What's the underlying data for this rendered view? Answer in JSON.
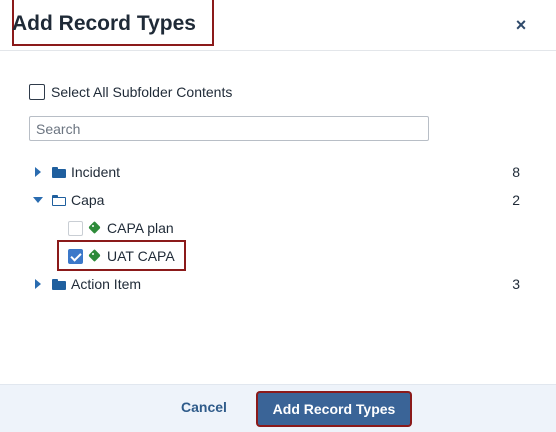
{
  "dialog": {
    "title": "Add Record Types",
    "close_label": "×"
  },
  "select_all": {
    "label": "Select All Subfolder Contents",
    "checked": false
  },
  "search": {
    "placeholder": "Search",
    "value": ""
  },
  "tree": {
    "folders": [
      {
        "name": "Incident",
        "count": "8",
        "expanded": false
      },
      {
        "name": "Capa",
        "count": "2",
        "expanded": true,
        "children": [
          {
            "name": "CAPA plan",
            "checked": false
          },
          {
            "name": "UAT CAPA",
            "checked": true
          }
        ]
      },
      {
        "name": "Action Item",
        "count": "3",
        "expanded": false
      }
    ]
  },
  "footer": {
    "cancel_label": "Cancel",
    "submit_label": "Add Record Types"
  },
  "colors": {
    "primary_button": "#3a6497",
    "highlight_outline": "#8b1a1a",
    "tag_icon": "#2e8b3a",
    "folder_icon": "#1f5f9e",
    "footer_bg": "#eef3fa"
  },
  "icons": {
    "close": "close-icon",
    "folder": "folder-icon",
    "folder_open": "folder-open-icon",
    "tag": "tag-icon",
    "caret_right": "caret-right-icon",
    "caret_down": "caret-down-icon"
  }
}
